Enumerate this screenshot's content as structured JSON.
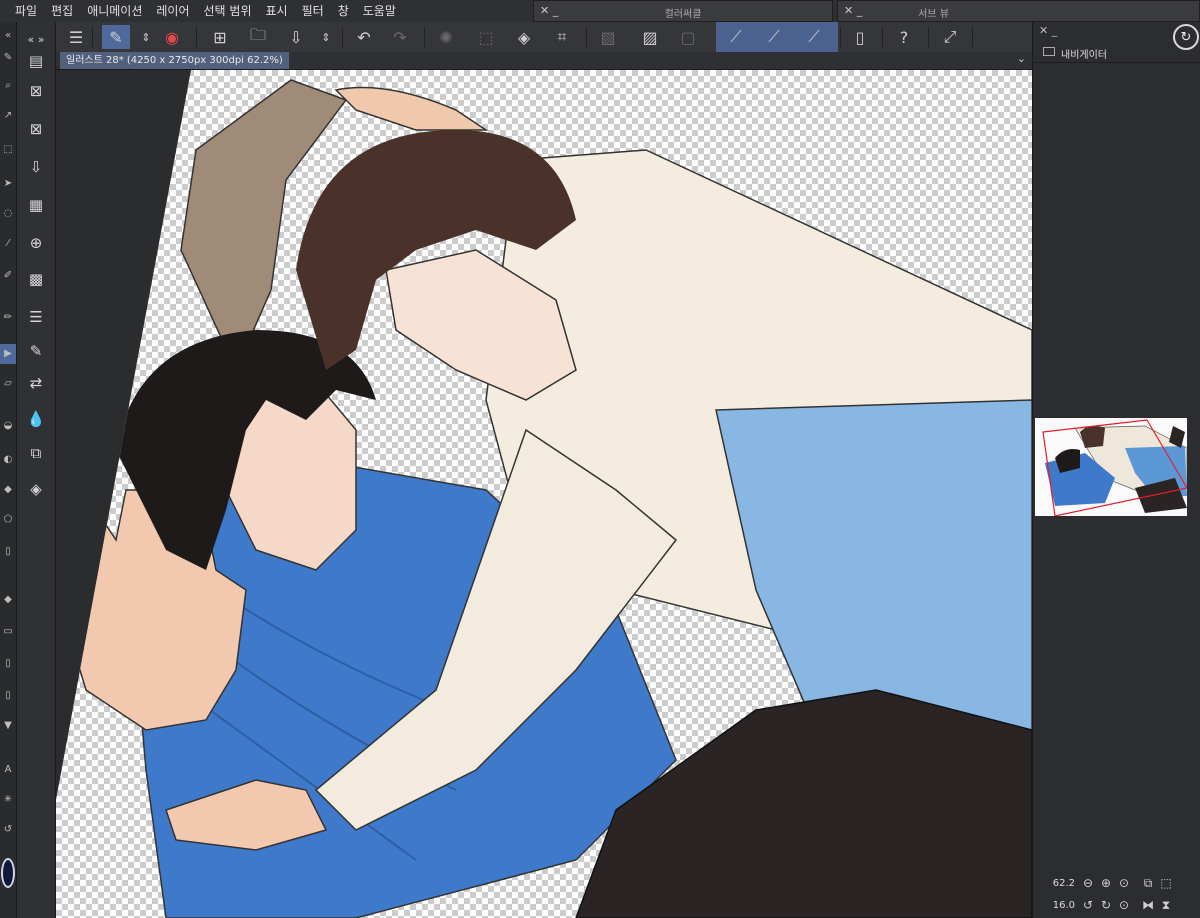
{
  "menu": [
    "파일",
    "편집",
    "애니메이션",
    "레이어",
    "선택 범위",
    "표시",
    "필터",
    "창",
    "도움말"
  ],
  "float_panels": {
    "color_circle": "컬러써클",
    "sub_view": "서브 뷰"
  },
  "document_tab": "일러스트 28* (4250 x 2750px 300dpi 62.2%)",
  "navigator": {
    "tab_label": "내비게이터",
    "zoom": "62.2",
    "rotation": "16.0"
  },
  "icons": {
    "menu": "hamburger-icon",
    "transparency": "checker-icon",
    "undo": "undo-icon",
    "redo": "redo-icon"
  },
  "colors": {
    "accent": "#4e6a9c",
    "panel": "#2b2c2e",
    "doctab": "#51607c"
  }
}
